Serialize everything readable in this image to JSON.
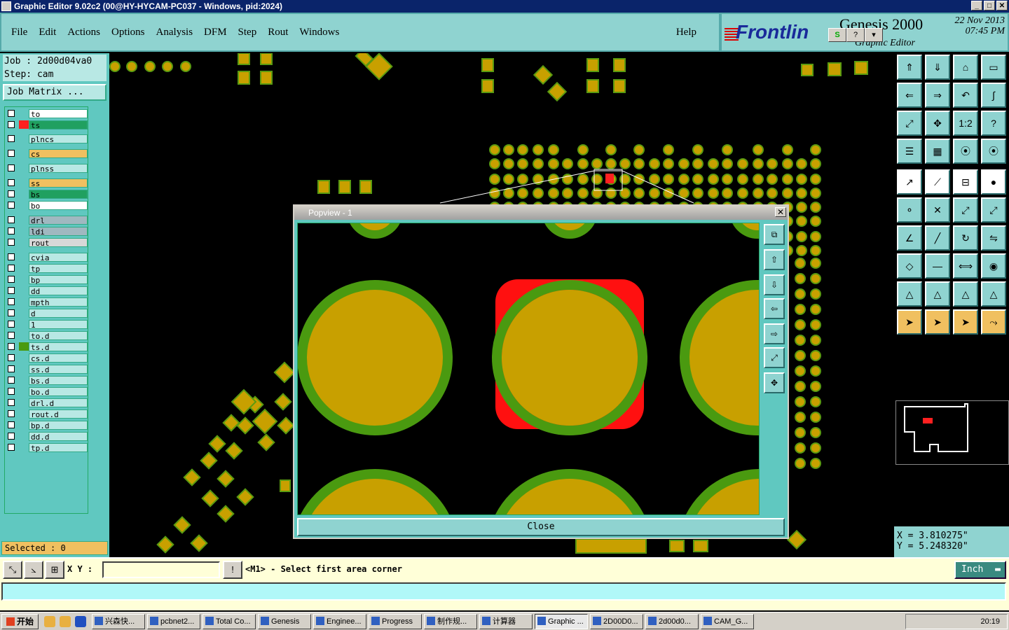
{
  "window": {
    "title": "Graphic Editor 9.02c2 (00@HY-HYCAM-PC037 - Windows, pid:2024)"
  },
  "menu": [
    "File",
    "Edit",
    "Actions",
    "Options",
    "Analysis",
    "DFM",
    "Step",
    "Rout",
    "Windows"
  ],
  "help": "Help",
  "brand": {
    "logo": "Frontlin",
    "product": "Genesis 2000",
    "subtitle": "Graphic Editor",
    "date": "22 Nov 2013",
    "time": "07:45 PM"
  },
  "job": {
    "job_line": "Job : 2d00d04va0",
    "step_line": "Step: cam",
    "matrix_button": "Job Matrix ..."
  },
  "layers": [
    {
      "name": "to",
      "bg": "#ffffff",
      "swatch": ""
    },
    {
      "name": "ts",
      "bg": "#20a060",
      "swatch": "#ff2020"
    },
    {
      "name": "plncs",
      "bg": "#b8e8e4",
      "swatch": ""
    },
    {
      "name": "cs",
      "bg": "#f0c060",
      "swatch": ""
    },
    {
      "name": "plnss",
      "bg": "#b8e8e4",
      "swatch": ""
    },
    {
      "name": "ss",
      "bg": "#f0c060",
      "swatch": ""
    },
    {
      "name": "bs",
      "bg": "#20a060",
      "swatch": ""
    },
    {
      "name": "bo",
      "bg": "#ffffff",
      "swatch": ""
    },
    {
      "name": "drl",
      "bg": "#a0b8c0",
      "swatch": ""
    },
    {
      "name": "ldi",
      "bg": "#a0b8c0",
      "swatch": ""
    },
    {
      "name": "rout",
      "bg": "#d8d8d8",
      "swatch": ""
    },
    {
      "name": "cvia",
      "bg": "#b8e8e4",
      "swatch": ""
    },
    {
      "name": "tp",
      "bg": "#b8e8e4",
      "swatch": ""
    },
    {
      "name": "bp",
      "bg": "#b8e8e4",
      "swatch": ""
    },
    {
      "name": "dd",
      "bg": "#b8e8e4",
      "swatch": ""
    },
    {
      "name": "mpth",
      "bg": "#b8e8e4",
      "swatch": ""
    },
    {
      "name": "d",
      "bg": "#b8e8e4",
      "swatch": ""
    },
    {
      "name": "1",
      "bg": "#b8e8e4",
      "swatch": ""
    },
    {
      "name": "to.d",
      "bg": "#b8e8e4",
      "swatch": ""
    },
    {
      "name": "ts.d",
      "bg": "#b8e8e4",
      "swatch": "#4a9a10"
    },
    {
      "name": "cs.d",
      "bg": "#b8e8e4",
      "swatch": ""
    },
    {
      "name": "ss.d",
      "bg": "#b8e8e4",
      "swatch": ""
    },
    {
      "name": "bs.d",
      "bg": "#b8e8e4",
      "swatch": ""
    },
    {
      "name": "bo.d",
      "bg": "#b8e8e4",
      "swatch": ""
    },
    {
      "name": "drl.d",
      "bg": "#b8e8e4",
      "swatch": ""
    },
    {
      "name": "rout.d",
      "bg": "#b8e8e4",
      "swatch": ""
    },
    {
      "name": "bp.d",
      "bg": "#b8e8e4",
      "swatch": ""
    },
    {
      "name": "dd.d",
      "bg": "#b8e8e4",
      "swatch": ""
    },
    {
      "name": "tp.d",
      "bg": "#b8e8e4",
      "swatch": ""
    }
  ],
  "selected": "Selected : 0",
  "popview": {
    "title": "Popview - 1",
    "close_label": "Close"
  },
  "coords": {
    "x": "X = 3.810275\"",
    "y": "Y = 5.248320\""
  },
  "status": {
    "xy_label": "X Y :",
    "xy_value": "",
    "prompt": "<M1> - Select first area corner",
    "unit": "Inch"
  },
  "tool_labels": {
    "one_two": "1:2",
    "question": "?"
  },
  "taskbar": {
    "start": "开始",
    "items": [
      "兴森快...",
      "pcbnet2...",
      "Total Co...",
      "Genesis",
      "Enginee...",
      "Progress",
      "制作规...",
      "计算器",
      "Graphic ...",
      "2D00D0...",
      "2d00d0...",
      "CAM_G..."
    ],
    "active_index": 8,
    "clock": "20:19"
  },
  "colors": {
    "pad_fill": "#c8a000",
    "pad_ring": "#4a9a10",
    "panel_bg": "#8fd3d0",
    "highlight": "#ff2020"
  }
}
